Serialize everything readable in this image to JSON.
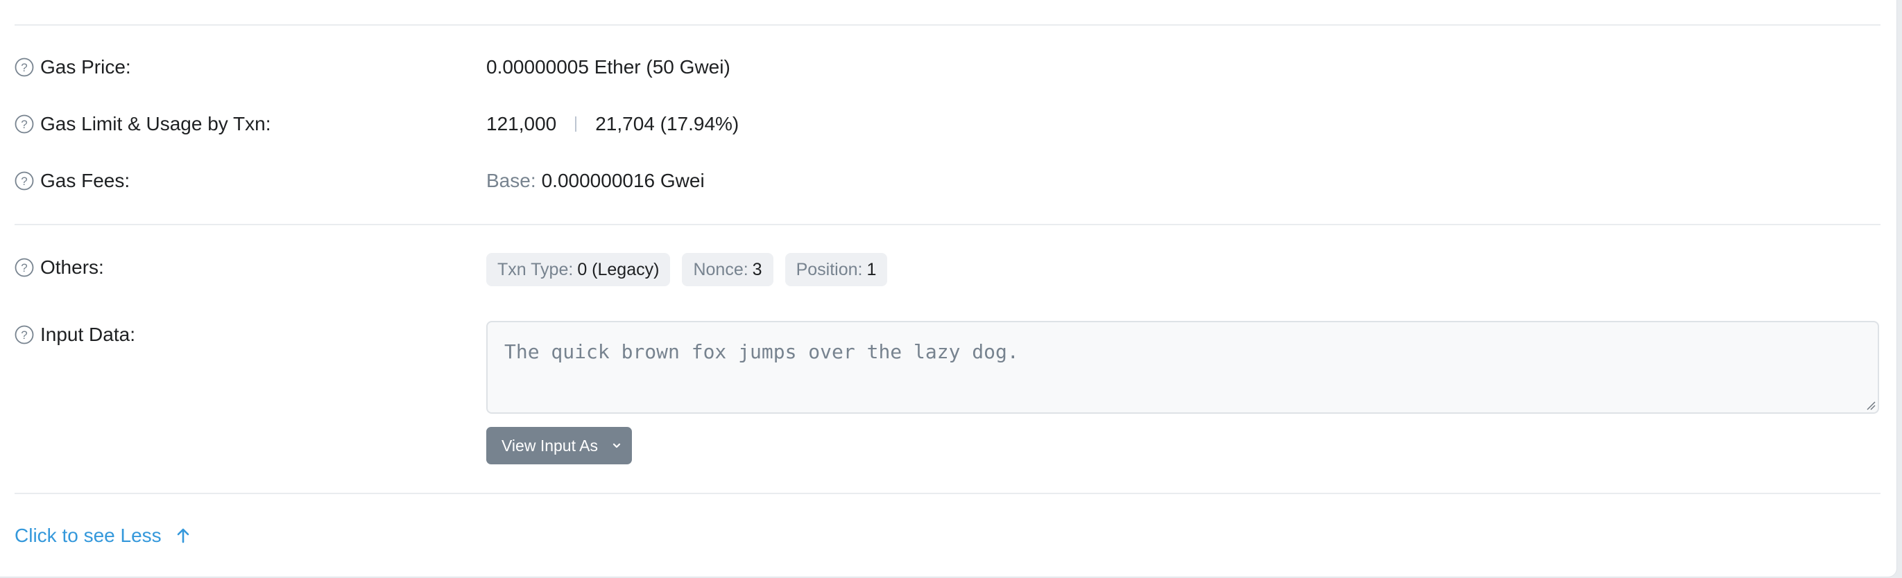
{
  "gas_price": {
    "label": "Gas Price:",
    "value": "0.00000005 Ether (50 Gwei)"
  },
  "gas_limit": {
    "label": "Gas Limit & Usage by Txn:",
    "limit": "121,000",
    "usage": "21,704 (17.94%)"
  },
  "gas_fees": {
    "label": "Gas Fees:",
    "base_label": "Base:",
    "base_value": "0.000000016 Gwei"
  },
  "others": {
    "label": "Others:",
    "badges": [
      {
        "key": "Txn Type:",
        "value": "0 (Legacy)"
      },
      {
        "key": "Nonce:",
        "value": "3"
      },
      {
        "key": "Position:",
        "value": "1"
      }
    ]
  },
  "input_data": {
    "label": "Input Data:",
    "text": "The quick brown fox jumps over the lazy dog.",
    "view_button": "View Input As"
  },
  "footer": {
    "toggle_link": "Click to see Less"
  },
  "icons": {
    "help": "question-circle-icon",
    "caret": "chevron-down-icon",
    "arrow": "arrow-up-icon"
  },
  "colors": {
    "link": "#3498db",
    "button": "#77838f",
    "muted_text": "#77838f",
    "badge_bg": "#eef0f3"
  }
}
